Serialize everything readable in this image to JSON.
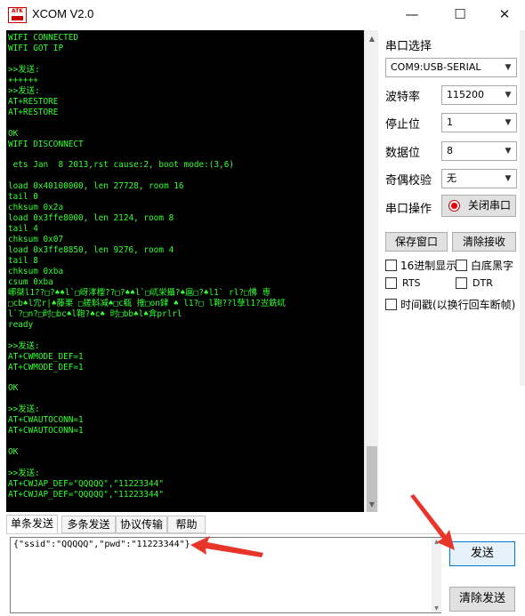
{
  "window": {
    "title": "XCOM V2.0",
    "logo_text": "ATK",
    "minimize_glyph": "—",
    "maximize_glyph": "☐",
    "close_glyph": "✕"
  },
  "terminal": {
    "lines": [
      "WIFI CONNECTED",
      "WIFI GOT IP",
      "",
      ">>发送:",
      "++++++",
      ">>发送:",
      "AT+RESTORE",
      "AT+RESTORE",
      "",
      "OK",
      "WIFI DISCONNECT",
      "",
      " ets Jan  8 2013,rst cause:2, boot mode:(3,6)",
      "",
      "load 0x40100000, len 27728, room 16",
      "tail 0",
      "chksum 0x2a",
      "load 0x3ffe8000, len 2124, room 8",
      "tail 4",
      "chksum 0x07",
      "load 0x3ffe8850, len 9276, room 4",
      "tail 8",
      "chksum 0xba",
      "csum 0xba",
      "峫桀l1??□?♠♠l`□岈涍檉??□?♠♠l`□屼栄攝?♠扈□?♠l1` rl?□怫 専",
      "□cb♠l宂r|♠藤栗 □搓斛减♠□c瓻 搉□on銉 ♠ l1?□ l鞄??l孽l1?岦銑屼",
      "l`?□n?□时□bc♠l鞄?♠c♠ 时□bb♠l♠弇prlrl",
      "ready",
      "",
      ">>发送:",
      "AT+CWMODE_DEF=1",
      "AT+CWMODE_DEF=1",
      "",
      "OK",
      "",
      ">>发送:",
      "AT+CWAUTOCONN=1",
      "AT+CWAUTOCONN=1",
      "",
      "OK",
      "",
      ">>发送:",
      "AT+CWJAP_DEF=\"QQQQQ\",\"11223344\"",
      "AT+CWJAP_DEF=\"QQQQQ\",\"11223344\""
    ]
  },
  "settings": {
    "port_label": "串口选择",
    "port_value": "COM9:USB-SERIAL",
    "baud_label": "波特率",
    "baud_value": "115200",
    "stopbit_label": "停止位",
    "stopbit_value": "1",
    "databit_label": "数据位",
    "databit_value": "8",
    "parity_label": "奇偶校验",
    "parity_value": "无",
    "port_op_label": "串口操作",
    "close_port_button": "关闭串口",
    "save_window_button": "保存窗口",
    "clear_receive_button": "清除接收",
    "hex_display": "16进制显示",
    "white_bg_black_text": "白底黑字",
    "rts": "RTS",
    "dtr": "DTR",
    "timestamp": "时间戳(以换行回车断帧)"
  },
  "tabs": {
    "single_send": "单条发送",
    "multi_send": "多条发送",
    "protocol": "协议传输",
    "help": "帮助"
  },
  "send": {
    "input_value": "{\"ssid\":\"QQQQQ\",\"pwd\":\"11223344\"}",
    "send_button": "发送",
    "clear_send_button": "清除发送"
  },
  "colors": {
    "terminal_text": "#33ff33",
    "terminal_bg": "#000000",
    "annotation_arrow": "#e8352a"
  }
}
